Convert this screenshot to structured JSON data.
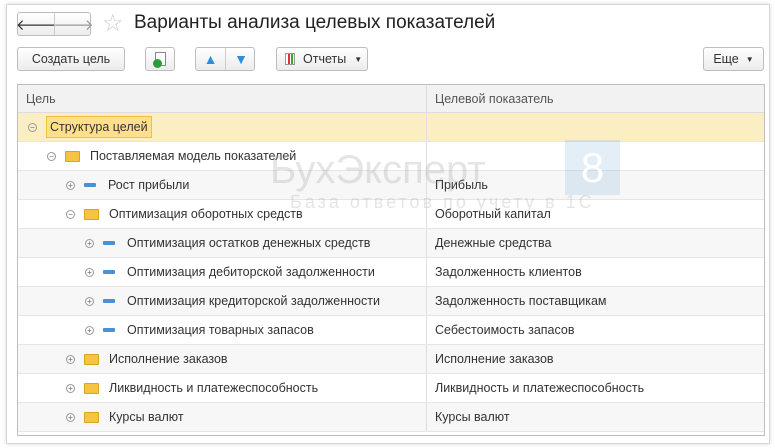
{
  "title": "Варианты анализа целевых показателей",
  "toolbar": {
    "create": "Создать цель",
    "reports": "Отчеты",
    "more": "Еще"
  },
  "columns": [
    "Цель",
    "Целевой показатель"
  ],
  "rows": [
    {
      "level": 0,
      "exp": "minus",
      "icon": "none",
      "name": "Структура целей",
      "target": ""
    },
    {
      "level": 1,
      "exp": "minus",
      "icon": "folder",
      "name": "Поставляемая модель показателей",
      "target": ""
    },
    {
      "level": 2,
      "exp": "plus",
      "icon": "dash",
      "name": "Рост прибыли",
      "target": "Прибыль"
    },
    {
      "level": 2,
      "exp": "minus",
      "icon": "folder",
      "name": "Оптимизация оборотных средств",
      "target": "Оборотный капитал"
    },
    {
      "level": 3,
      "exp": "plus",
      "icon": "dash",
      "name": "Оптимизация остатков денежных средств",
      "target": "Денежные средства"
    },
    {
      "level": 3,
      "exp": "plus",
      "icon": "dash",
      "name": "Оптимизация дебиторской задолженности",
      "target": "Задолженность клиентов"
    },
    {
      "level": 3,
      "exp": "plus",
      "icon": "dash",
      "name": "Оптимизация кредиторской задолженности",
      "target": "Задолженность поставщикам"
    },
    {
      "level": 3,
      "exp": "plus",
      "icon": "dash",
      "name": "Оптимизация товарных запасов",
      "target": "Себестоимость запасов"
    },
    {
      "level": 2,
      "exp": "plus",
      "icon": "folder",
      "name": "Исполнение заказов",
      "target": "Исполнение заказов"
    },
    {
      "level": 2,
      "exp": "plus",
      "icon": "folder",
      "name": "Ликвидность и платежеспособность",
      "target": "Ликвидность и платежеспособность"
    },
    {
      "level": 2,
      "exp": "plus",
      "icon": "folder",
      "name": "Курсы валют",
      "target": "Курсы валют"
    }
  ],
  "watermark": {
    "brand": "БухЭксперт",
    "num": "8",
    "sub": "База ответов по учету в 1С"
  }
}
